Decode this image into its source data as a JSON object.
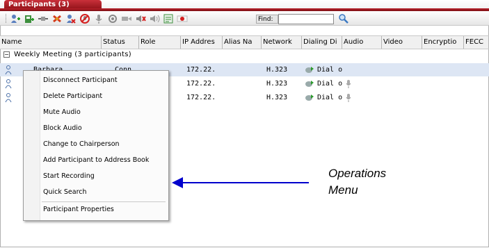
{
  "window": {
    "title": "Participants (3)"
  },
  "colors": {
    "accent": "#b8202a",
    "selection": "#dde6f4",
    "callout_arrow": "#0000cc"
  },
  "toolbar": {
    "icons": [
      "add-participant-icon",
      "address-book-icon",
      "connect-icon",
      "disconnect-icon",
      "delete-participant-icon",
      "mute-audio-icon",
      "mic-icon",
      "camera-icon",
      "video-icon",
      "block-audio-icon",
      "volume-icon",
      "participant-properties-icon",
      "record-icon"
    ],
    "find_label": "Find:",
    "find_value": ""
  },
  "columns": [
    "Name",
    "Status",
    "Role",
    "IP Addres",
    "Alias Na",
    "Network",
    "Dialing Di",
    "Audio",
    "Video",
    "Encryptio",
    "FECC"
  ],
  "group": {
    "label": "Weekly Meeting (3  participants)"
  },
  "rows": [
    {
      "name": "Barbara",
      "status": "Conn",
      "ip": "172.22.",
      "network": "H.323",
      "dialing": "Dial o"
    },
    {
      "name": "",
      "status": "",
      "ip": "172.22.",
      "network": "H.323",
      "dialing": "Dial o"
    },
    {
      "name": "",
      "status": "",
      "ip": "172.22.",
      "network": "H.323",
      "dialing": "Dial o"
    }
  ],
  "context_menu": {
    "items": [
      "Disconnect Participant",
      "Delete Participant",
      "Mute Audio",
      "Block Audio",
      "Change to Chairperson",
      "Add Participant to Address Book",
      "Start Recording",
      "Quick Search",
      "Participant Properties"
    ]
  },
  "annotation": {
    "line1": "Operations",
    "line2": "Menu"
  }
}
